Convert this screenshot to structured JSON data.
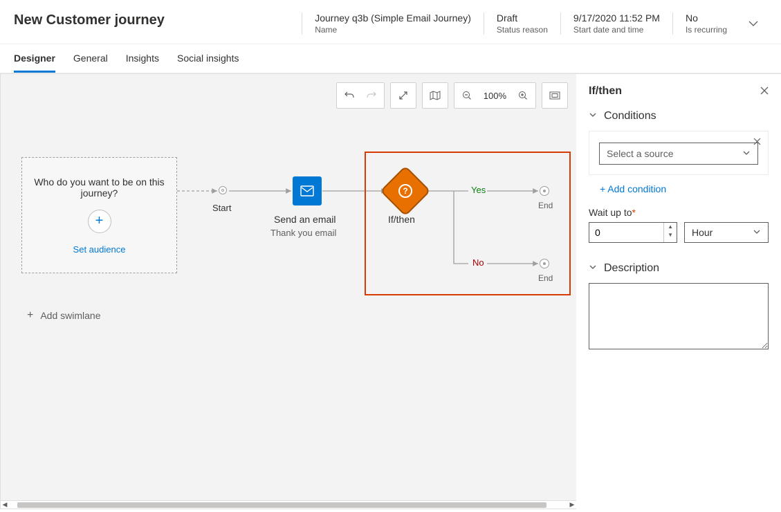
{
  "header": {
    "title": "New Customer journey",
    "meta": [
      {
        "value": "Journey q3b (Simple Email Journey)",
        "label": "Name"
      },
      {
        "value": "Draft",
        "label": "Status reason"
      },
      {
        "value": "9/17/2020 11:52 PM",
        "label": "Start date and time"
      },
      {
        "value": "No",
        "label": "Is recurring"
      }
    ]
  },
  "tabs": [
    "Designer",
    "General",
    "Insights",
    "Social insights"
  ],
  "toolbar": {
    "zoom": "100%"
  },
  "canvas": {
    "audience_question": "Who do you want to be on this journey?",
    "set_audience": "Set audience",
    "add_swimlane": "Add swimlane",
    "start": "Start",
    "email_title": "Send an email",
    "email_sub": "Thank you email",
    "ifthen": "If/then",
    "yes": "Yes",
    "no": "No",
    "end": "End"
  },
  "panel": {
    "title": "If/then",
    "conditions_header": "Conditions",
    "select_source_placeholder": "Select a source",
    "add_condition": "+ Add condition",
    "wait_label": "Wait up to",
    "wait_value": "0",
    "wait_unit": "Hour",
    "description_header": "Description",
    "description_value": ""
  }
}
